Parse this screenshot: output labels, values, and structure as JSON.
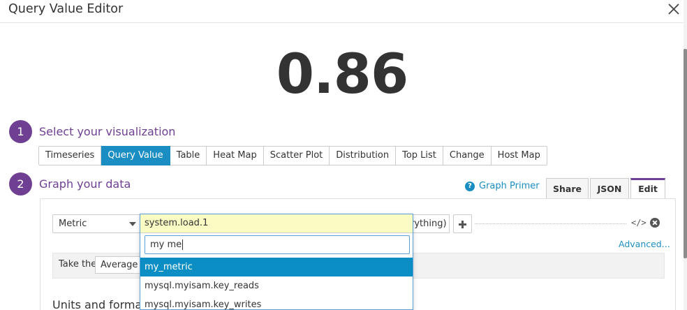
{
  "window": {
    "title": "Query Value Editor"
  },
  "preview": {
    "value": "0.86"
  },
  "steps": [
    {
      "number": "1",
      "label": "Select your visualization"
    },
    {
      "number": "2",
      "label": "Graph your data"
    }
  ],
  "visualizations": [
    "Timeseries",
    "Query Value",
    "Table",
    "Heat Map",
    "Scatter Plot",
    "Distribution",
    "Top List",
    "Change",
    "Host Map"
  ],
  "active_visualization": "Query Value",
  "graph": {
    "primer_label": "Graph Primer",
    "tabs": [
      "Share",
      "JSON",
      "Edit"
    ],
    "active_tab": "Edit",
    "source_select": "Metric",
    "from_value": "rything)",
    "code_icon": "</>",
    "advanced_label": "Advanced...",
    "take_label": "Take the",
    "aggregation": "Average",
    "units_label": "Units and format"
  },
  "metric_dropdown": {
    "selected": "system.load.1",
    "search": "my me",
    "options": [
      "my_metric",
      "mysql.myisam.key_reads",
      "mysql.myisam.key_writes"
    ],
    "highlighted_index": 0
  },
  "colors": {
    "accent_purple": "#6e3f92",
    "accent_blue": "#1a8dc2",
    "highlight": "#0b8ec4"
  }
}
